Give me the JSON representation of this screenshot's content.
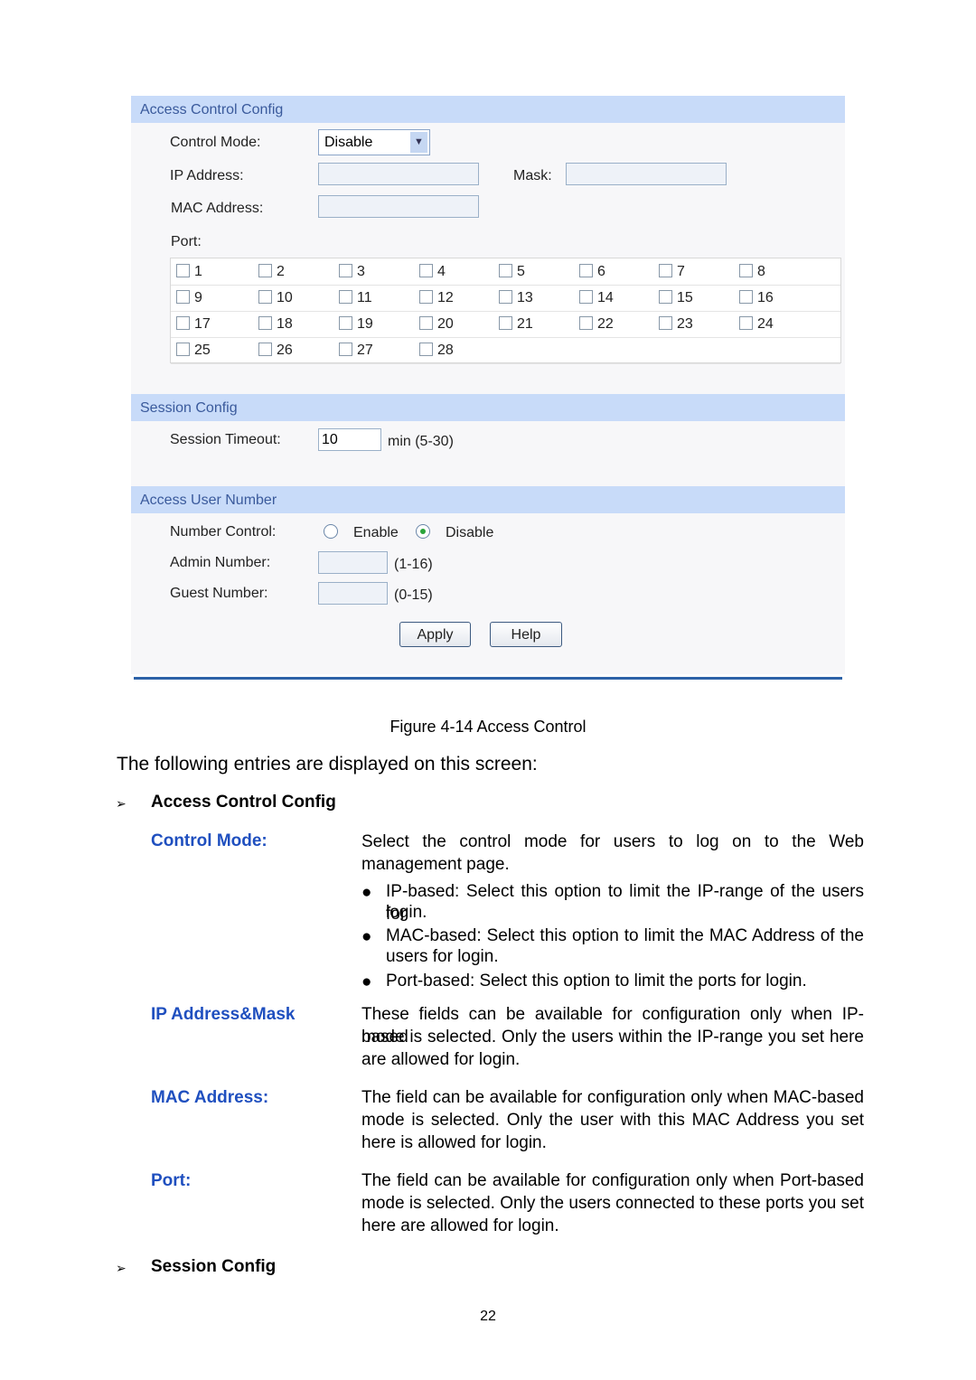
{
  "access_control": {
    "title": "Access Control Config",
    "control_mode_label": "Control Mode:",
    "control_mode_value": "Disable",
    "ip_label": "IP Address:",
    "mask_label": "Mask:",
    "mac_label": "MAC Address:",
    "port_label": "Port:",
    "ports": [
      "1",
      "2",
      "3",
      "4",
      "5",
      "6",
      "7",
      "8",
      "9",
      "10",
      "11",
      "12",
      "13",
      "14",
      "15",
      "16",
      "17",
      "18",
      "19",
      "20",
      "21",
      "22",
      "23",
      "24",
      "25",
      "26",
      "27",
      "28"
    ]
  },
  "session": {
    "title": "Session Config",
    "timeout_label": "Session Timeout:",
    "timeout_value": "10",
    "timeout_hint": "min (5-30)"
  },
  "user_number": {
    "title": "Access User Number",
    "number_control_label": "Number Control:",
    "enable": "Enable",
    "disable": "Disable",
    "selected": "Disable",
    "admin_label": "Admin Number:",
    "admin_hint": "(1-16)",
    "guest_label": "Guest Number:",
    "guest_hint": "(0-15)",
    "apply": "Apply",
    "help": "Help"
  },
  "doc": {
    "caption": "Figure 4-14 Access Control",
    "intro": "The following entries are displayed on this screen:",
    "section1": "Access Control Config",
    "control_mode_term": "Control Mode:",
    "control_mode_desc1": "Select the control mode for users to log on to the Web",
    "control_mode_desc2": "management page.",
    "b1a": "IP-based: Select this option to limit the IP-range of the users for",
    "b1b": "login.",
    "b2a": "MAC-based: Select this option to limit the MAC Address of the",
    "b2b": "users for login.",
    "b3": "Port-based: Select this option to limit the ports for login.",
    "ip_term": "IP Address&Mask",
    "ip_d1": "These fields can be available for configuration only when IP-based",
    "ip_d2": "mode is selected. Only the users within the IP-range you set here",
    "ip_d3": "are allowed for login.",
    "mac_term": "MAC Address:",
    "mac_d1": "The field can be available for configuration only when MAC-based",
    "mac_d2": "mode is selected. Only the user with this MAC Address you set",
    "mac_d3": "here is allowed for login.",
    "port_term": "Port:",
    "port_d1": "The field can be available for configuration only when Port-based",
    "port_d2": "mode is selected. Only the users connected to these ports you set",
    "port_d3": "here are allowed for login.",
    "section2": "Session Config",
    "page_number": "22"
  }
}
